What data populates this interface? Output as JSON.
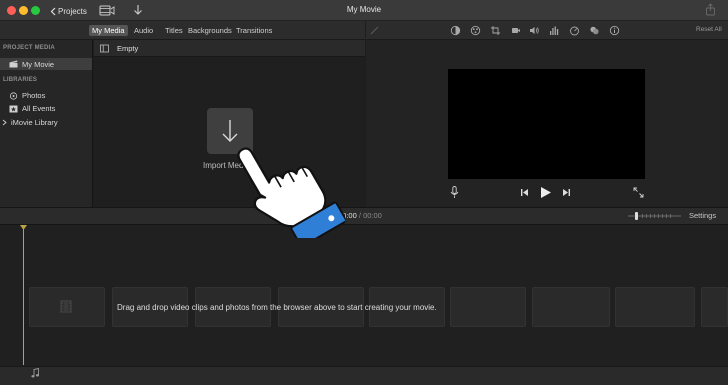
{
  "window": {
    "title": "My Movie",
    "back_label": "Projects"
  },
  "tabs": [
    {
      "label": "My Media",
      "active": true
    },
    {
      "label": "Audio",
      "active": false
    },
    {
      "label": "Titles",
      "active": false
    },
    {
      "label": "Backgrounds",
      "active": false
    },
    {
      "label": "Transitions",
      "active": false
    }
  ],
  "viewer_toolbar": {
    "icons": [
      "magic-wand-icon",
      "color-balance-icon",
      "color-correction-icon",
      "crop-icon",
      "stabilization-icon",
      "volume-icon",
      "noise-equalizer-icon",
      "speed-icon",
      "clip-filter-icon",
      "info-icon"
    ],
    "reset_label": "Reset All"
  },
  "sidebar": {
    "project_header": "PROJECT MEDIA",
    "project_item": "My Movie",
    "libraries_header": "LIBRARIES",
    "library_items": [
      "Photos",
      "All Events"
    ],
    "library_root": "iMovie Library"
  },
  "browser": {
    "header_label": "Empty",
    "import_label": "Import Media"
  },
  "playback": {
    "current_time": "00:00",
    "separator": "/",
    "total_time": "00:00",
    "settings_label": "Settings"
  },
  "timeline": {
    "drop_hint": "Drag and drop video clips and photos from the browser above to start creating your movie."
  },
  "colors": {
    "accent_selected": "#555555",
    "playhead": "#b9a24a",
    "hand_cuff": "#2f7fd6"
  }
}
